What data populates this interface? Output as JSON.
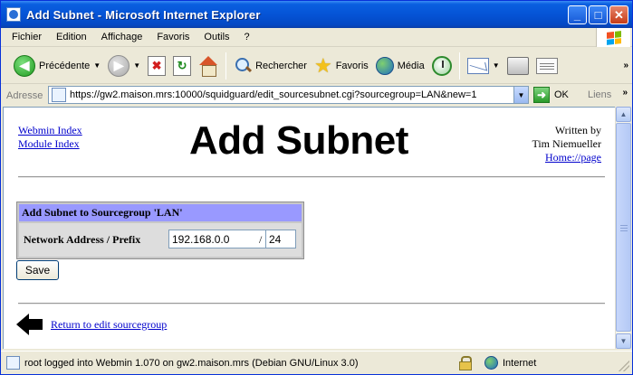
{
  "window": {
    "title": "Add Subnet - Microsoft Internet Explorer",
    "buttons": {
      "minimize": "_",
      "maximize": "□",
      "close": "✕"
    }
  },
  "menubar": {
    "items": [
      "Fichier",
      "Edition",
      "Affichage",
      "Favoris",
      "Outils",
      "?"
    ]
  },
  "toolbar": {
    "back_label": "Précédente",
    "search_label": "Rechercher",
    "favorites_label": "Favoris",
    "media_label": "Média"
  },
  "addressbar": {
    "label": "Adresse",
    "url": "https://gw2.maison.mrs:10000/squidguard/edit_sourcesubnet.cgi?sourcegroup=LAN&new=1",
    "go_label": "OK",
    "links_label": "Liens"
  },
  "page": {
    "nav": {
      "webmin_index": "Webmin Index",
      "module_index": "Module Index"
    },
    "heading": "Add Subnet",
    "credits": {
      "line1": "Written by",
      "line2": "Tim Niemueller",
      "homepage_link": "Home://page"
    },
    "form": {
      "section_title": "Add Subnet to Sourcegroup 'LAN'",
      "field_label": "Network Address / Prefix",
      "network_value": "192.168.0.0",
      "separator": "/",
      "prefix_value": "24",
      "save_label": "Save"
    },
    "return_link": "Return to edit sourcegroup"
  },
  "statusbar": {
    "text": "root logged into Webmin 1.070 on gw2.maison.mrs (Debian GNU/Linux 3.0)",
    "zone": "Internet"
  },
  "colors": {
    "form_header_bg": "#9999ff",
    "link": "#0000cc",
    "titlebar": "#0554d6"
  }
}
